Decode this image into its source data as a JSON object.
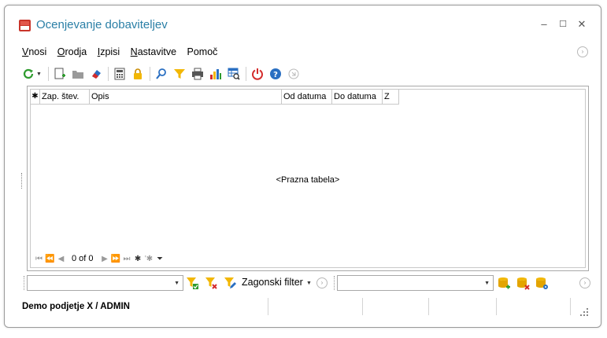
{
  "window": {
    "title": "Ocenjevanje dobaviteljev",
    "controls": {
      "minimize": "–",
      "maximize": "☐",
      "close": "✕"
    }
  },
  "menu": {
    "items": [
      {
        "underline": "V",
        "rest": "nosi"
      },
      {
        "underline": "O",
        "rest": "rodja"
      },
      {
        "underline": "I",
        "rest": "zpisi"
      },
      {
        "underline": "N",
        "rest": "astavitve"
      },
      {
        "underline": "",
        "rest": "Pomoč"
      }
    ]
  },
  "toolbar": {
    "icons": [
      "refresh-icon",
      "new-document-icon",
      "open-folder-icon",
      "eraser-icon",
      "calculator-icon",
      "lock-icon",
      "search-icon",
      "filter-icon",
      "print-icon",
      "chart-icon",
      "table-search-icon",
      "power-icon",
      "help-icon",
      "collapse-icon"
    ]
  },
  "grid": {
    "columns": [
      "",
      "Zap. štev.",
      "Opis",
      "Od datuma",
      "Do datuma",
      "Z"
    ],
    "empty_text": "<Prazna tabela>",
    "navigator_position": "0 of 0"
  },
  "filterbar": {
    "combo1_value": "",
    "combo2_value": "",
    "zagonski_label": "Zagonski filter"
  },
  "status": {
    "text": "Demo podjetje X / ADMIN"
  },
  "colors": {
    "title": "#2a7fa6",
    "accent_green": "#2e9b2e",
    "accent_yellow": "#f2b705",
    "accent_red": "#d42c2c",
    "accent_blue": "#2a6fc2"
  }
}
